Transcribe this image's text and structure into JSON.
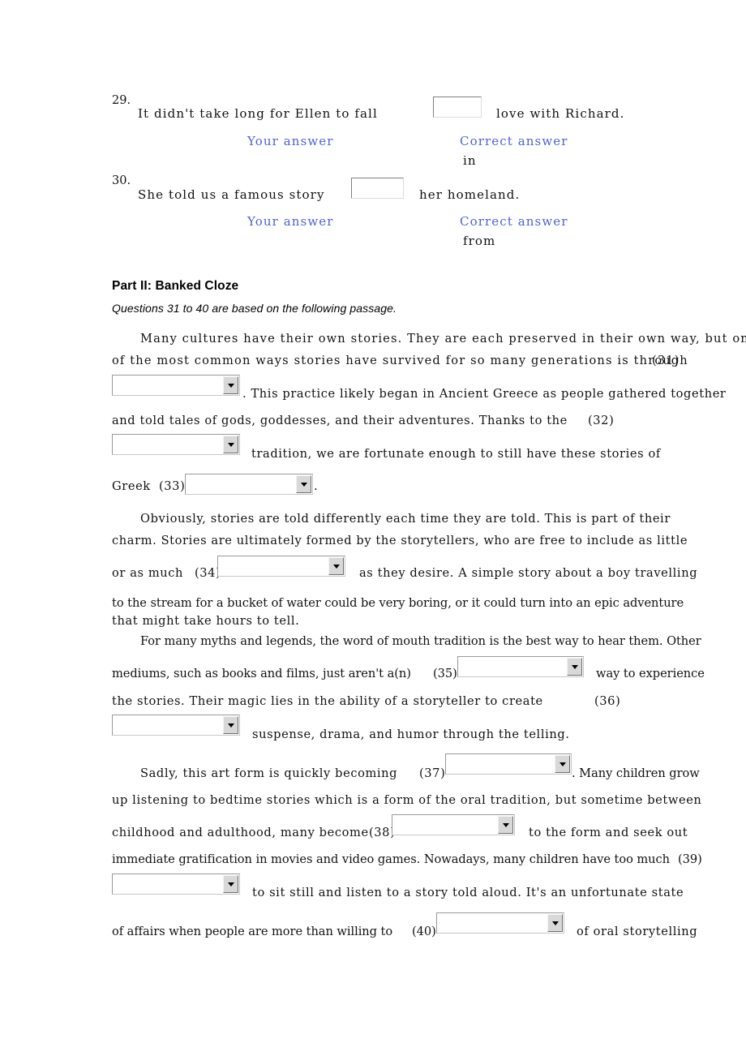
{
  "meta": {
    "accent_blue": "#4a63d8",
    "text_color": "#111111",
    "page_bg": "#ffffff"
  },
  "questions": [
    {
      "number": "29.",
      "text_before": "It didn't take long for Ellen to fall",
      "text_after": "love with Richard.",
      "your_answer_label": "Your answer",
      "your_answer_value": "",
      "correct_answer_label": "Correct answer",
      "correct_answer_value": "in"
    },
    {
      "number": "30.",
      "text_before": "She told us a famous story",
      "text_after": "her homeland.",
      "your_answer_label": "Your answer",
      "your_answer_value": "",
      "correct_answer_label": "Correct answer",
      "correct_answer_value": "from"
    }
  ],
  "part2": {
    "title": "Part II: Banked Cloze",
    "subtitle": "Questions 31 to 40 are based on the following passage.",
    "lines": {
      "l1": "Many cultures have their own stories. They are each preserved in their own way, but one",
      "l2a": "of the most common ways stories have survived for so many generations is through",
      "l2b": "(31)",
      "l3": ". This practice likely began in Ancient Greece as people gathered together",
      "l4a": "and told tales of gods, goddesses, and their adventures. Thanks to the",
      "l4b": "(32)",
      "l5": "tradition, we are fortunate enough to still have these stories of",
      "l6a": "Greek",
      "l6b": "(33)",
      "l6c": ".",
      "l7": "Obviously, stories are told differently each time they are told. This is part of their",
      "l8": "charm. Stories are ultimately formed by the storytellers, who are free to include as little",
      "l9a": "or as much",
      "l9b": "(34)",
      "l9c": "as they desire. A simple story about a boy travelling",
      "l10": "to the stream for a bucket of water could be very boring, or it could turn into an epic adventure",
      "l11": "that might take hours to tell.",
      "l12": "For many myths and legends, the word of mouth tradition is the best way to hear them. Other",
      "l13a": "mediums, such as books and films, just aren't a(n)",
      "l13b": "(35)",
      "l13c": "way to experience",
      "l14a": "the stories. Their magic lies in the ability of a storyteller to create",
      "l14b": "(36)",
      "l15": "suspense, drama, and humor through the telling.",
      "l16a": "Sadly, this art form is quickly becoming",
      "l16b": "(37)",
      "l16c": ". Many children grow",
      "l17": "up listening to bedtime stories which is a form of the oral tradition, but sometime between",
      "l18a": "childhood and adulthood, many become",
      "l18b": "(38)",
      "l18c": "to the form and seek out",
      "l19a": "immediate gratification in movies and video games. Nowadays, many children have too much",
      "l19b": "(39)",
      "l20": "to sit still and listen to a story told aloud. It's an unfortunate state",
      "l21a": "of affairs when people are more than willing to",
      "l21b": "(40)",
      "l21c": "of oral storytelling"
    },
    "blanks": [
      {
        "id": "31",
        "value": ""
      },
      {
        "id": "32",
        "value": ""
      },
      {
        "id": "33",
        "value": ""
      },
      {
        "id": "34",
        "value": ""
      },
      {
        "id": "35",
        "value": ""
      },
      {
        "id": "36",
        "value": ""
      },
      {
        "id": "37",
        "value": ""
      },
      {
        "id": "38",
        "value": ""
      },
      {
        "id": "39",
        "value": ""
      },
      {
        "id": "40",
        "value": ""
      }
    ]
  }
}
